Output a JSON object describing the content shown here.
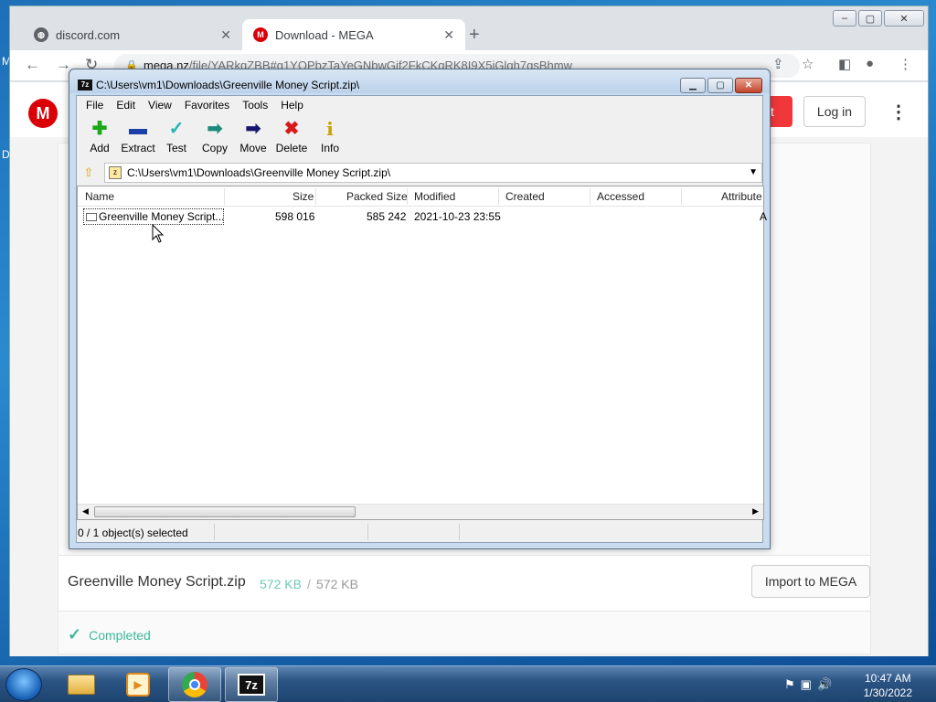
{
  "desktop": {
    "left_letters": [
      "M",
      "D"
    ]
  },
  "browser": {
    "tabs": [
      {
        "title": "discord.com",
        "active": false
      },
      {
        "title": "Download - MEGA",
        "active": true
      }
    ],
    "url_host": "mega.nz",
    "url_path": "/file/YARkqZBB#g1YOPbzTaYeGNbwGif2FkCKqRK8I9X5iGlqh7gsBhmw"
  },
  "mega": {
    "login_label": "Log in",
    "red_button_label": "t",
    "file_name": "Greenville Money Script.zip",
    "size_downloaded": "572 KB",
    "size_separator": "/",
    "size_total": "572 KB",
    "import_label": "Import to MEGA",
    "status": "Completed"
  },
  "sevenzip": {
    "title": "C:\\Users\\vm1\\Downloads\\Greenville Money Script.zip\\",
    "menu": [
      "File",
      "Edit",
      "View",
      "Favorites",
      "Tools",
      "Help"
    ],
    "toolbar": [
      "Add",
      "Extract",
      "Test",
      "Copy",
      "Move",
      "Delete",
      "Info"
    ],
    "address": "C:\\Users\\vm1\\Downloads\\Greenville Money Script.zip\\",
    "columns": [
      "Name",
      "Size",
      "Packed Size",
      "Modified",
      "Created",
      "Accessed",
      "Attribute"
    ],
    "rows": [
      {
        "name": "Greenville Money Script...",
        "size": "598 016",
        "packed": "585 242",
        "modified": "2021-10-23 23:55",
        "created": "",
        "accessed": "",
        "attribute": "A"
      }
    ],
    "status": "0 / 1 object(s) selected"
  },
  "taskbar": {
    "time": "10:47 AM",
    "date": "1/30/2022"
  },
  "colors": {
    "mega_red": "#d90007",
    "mega_teal": "#3db89d",
    "chrome_bar": "#dee1e6"
  }
}
